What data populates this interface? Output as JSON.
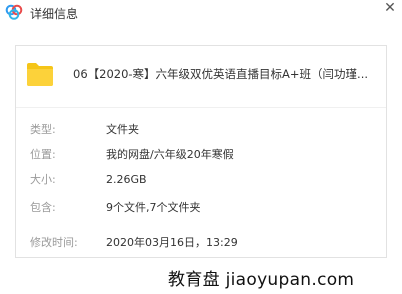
{
  "window": {
    "title": "详细信息",
    "close_icon": "close-icon"
  },
  "file": {
    "name": "06【2020-寒】六年级双优英语直播目标A+班（闫功瑾...",
    "icon": "folder-icon",
    "icon_color": "#f5c518"
  },
  "properties": [
    {
      "label": "类型:",
      "value": "文件夹"
    },
    {
      "label": "位置:",
      "value": "我的网盘/六年级20年寒假"
    },
    {
      "label": "大小:",
      "value": "2.26GB"
    },
    {
      "label": "包含:",
      "value": "9个文件,7个文件夹"
    },
    {
      "label": "修改时间:",
      "value": "2020年03月16日，13:29"
    }
  ],
  "watermark": "教育盘 jiaoyupan.com",
  "colors": {
    "label": "#9a9a9a",
    "value": "#333333",
    "logo_blue": "#2f9bf0"
  }
}
